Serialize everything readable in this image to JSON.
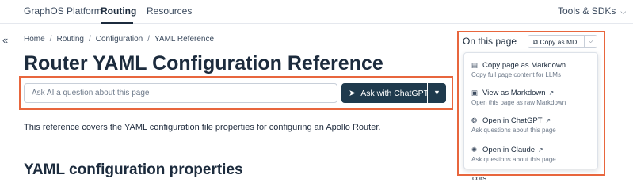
{
  "topnav": {
    "items": [
      {
        "label": "GraphOS Platform"
      },
      {
        "label": "Routing"
      },
      {
        "label": "Resources"
      }
    ],
    "right_menu": "Tools & SDKs"
  },
  "breadcrumb": [
    "Home",
    "Routing",
    "Configuration",
    "YAML Reference"
  ],
  "page_title": "Router YAML Configuration Reference",
  "ask": {
    "placeholder": "Ask AI a question about this page",
    "button_label": "Ask with ChatGPT"
  },
  "intro": {
    "before": "This reference covers the YAML configuration file properties for configuring an ",
    "link": "Apollo Router",
    "after": "."
  },
  "section_heading": "YAML configuration properties",
  "on_this_page": {
    "title": "On this page",
    "copy_button": "Copy as MD",
    "menu": [
      {
        "icon": "document-icon",
        "title": "Copy page as Markdown",
        "subtitle": "Copy full page content for LLMs"
      },
      {
        "icon": "markdown-icon",
        "title": "View as Markdown",
        "subtitle": "Open this page as raw Markdown"
      },
      {
        "icon": "chatgpt-icon",
        "title": "Open in ChatGPT",
        "subtitle": "Ask questions about this page"
      },
      {
        "icon": "claude-icon",
        "title": "Open in Claude",
        "subtitle": "Ask questions about this page"
      }
    ],
    "peek_item": "cors"
  },
  "colors": {
    "accent_dark": "#1f3a4d",
    "highlight": "#e8663d",
    "link_underline": "#4b8ec9"
  }
}
